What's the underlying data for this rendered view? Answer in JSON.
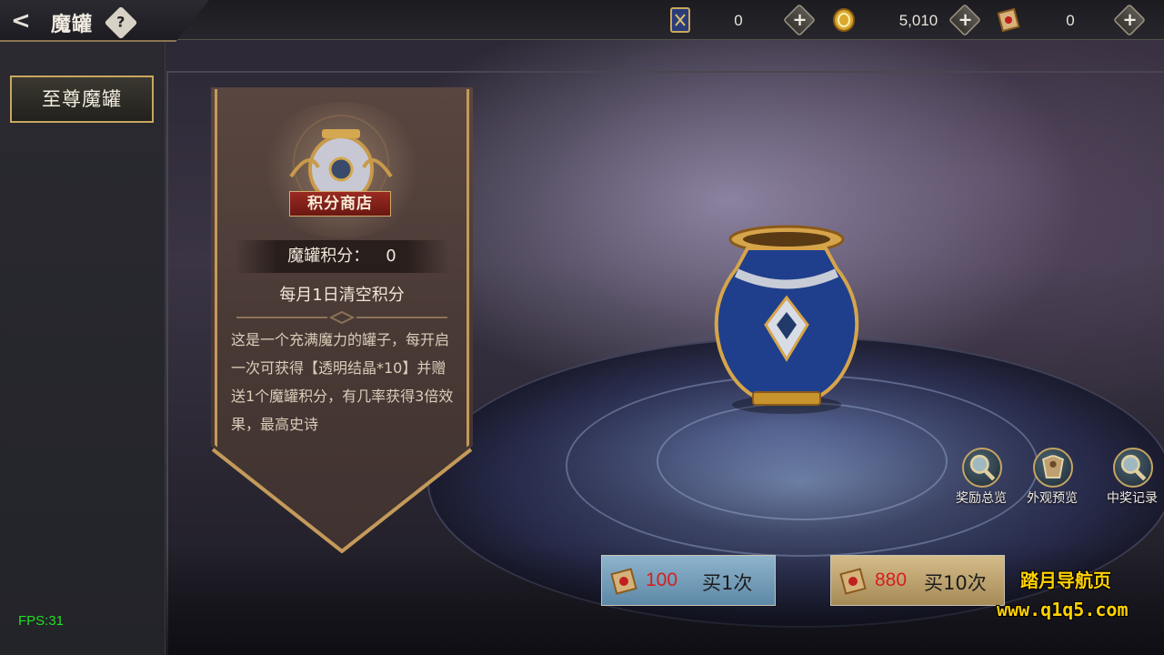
{
  "header": {
    "title": "魔罐",
    "help_symbol": "?",
    "back_symbol": "<"
  },
  "currencies": [
    {
      "icon": "card-icon",
      "value": "0"
    },
    {
      "icon": "gold-coin-icon",
      "value": "5,010"
    },
    {
      "icon": "scroll-icon",
      "value": "0"
    }
  ],
  "sidebar": {
    "tabs": [
      {
        "label": "至尊魔罐",
        "selected": true
      }
    ]
  },
  "info": {
    "shop_label": "积分商店",
    "points_label": "魔罐积分：",
    "points_value": "0",
    "reset_note": "每月1日清空积分",
    "description": "这是一个充满魔力的罐子，每开启一次可获得【透明结晶*10】并赠送1个魔罐积分，有几率获得3倍效果，最高史诗"
  },
  "side_buttons": [
    {
      "label": "奖励总览",
      "icon": "magnifier-icon"
    },
    {
      "label": "外观预览",
      "icon": "armor-icon"
    },
    {
      "label": "中奖记录",
      "icon": "magnifier-icon"
    }
  ],
  "buy": {
    "once": {
      "cost": "100",
      "label": "买1次"
    },
    "ten": {
      "cost": "880",
      "label": "买10次"
    }
  },
  "overlay": {
    "watermark_title": "踏月导航页",
    "watermark_url": "www.q1q5.com",
    "fps": "FPS:31"
  },
  "colors": {
    "accent_gold": "#c8a860",
    "cost_red": "#d61f1f",
    "fps_green": "#1ee01e",
    "watermark_yellow": "#ffd100"
  }
}
